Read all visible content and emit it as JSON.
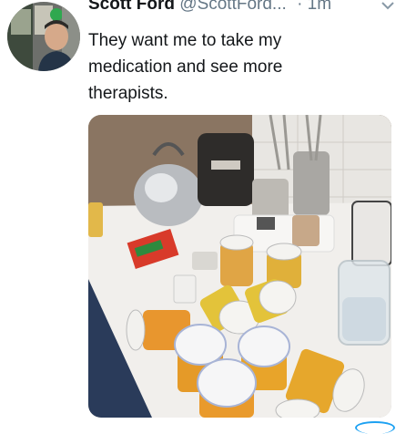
{
  "tweet": {
    "display_name": "Scott Ford",
    "handle": "@ScottFord...",
    "separator": "·",
    "time": "1m",
    "text": "They want me to take my medication and see more therapists.",
    "avatar_icon": "user-avatar-photo",
    "more_icon": "chevron-down-icon",
    "media_description_icon": "photo-icon"
  },
  "colors": {
    "name": "#14171a",
    "secondary": "#657786",
    "accent": "#1da1f2"
  }
}
